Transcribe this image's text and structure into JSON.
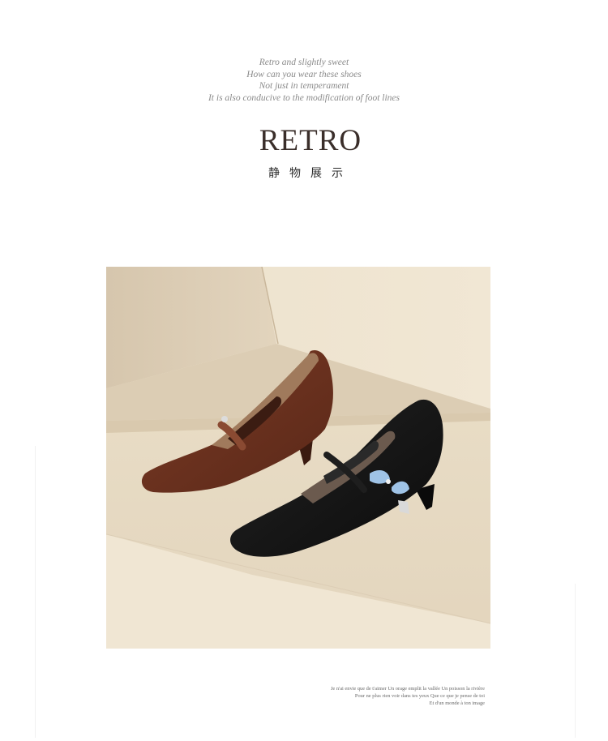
{
  "intro": {
    "lines": [
      "Retro and slightly sweet",
      "How can you wear these shoes",
      "Not just in temperament",
      "It is also conducive to the modification of foot lines"
    ]
  },
  "heading": {
    "title": "RETRO",
    "subtitle": "静物展示"
  },
  "photo": {
    "subject": "brown suede and black suede square-toe Mary Jane kitten-heel pumps on beige steps",
    "colors": {
      "backdrop": "#e9dcc6",
      "brown_shoe": "#6b3220",
      "black_shoe": "#141414"
    }
  },
  "caption": {
    "lines": [
      "Je n'ai envie que de t'aimer Un orage emplit la vallée Un poisson la rivière",
      "Pour ne plus rien voir dans tes yeux Que ce que je pense de toi",
      "Et d'un monde à ton image"
    ]
  }
}
